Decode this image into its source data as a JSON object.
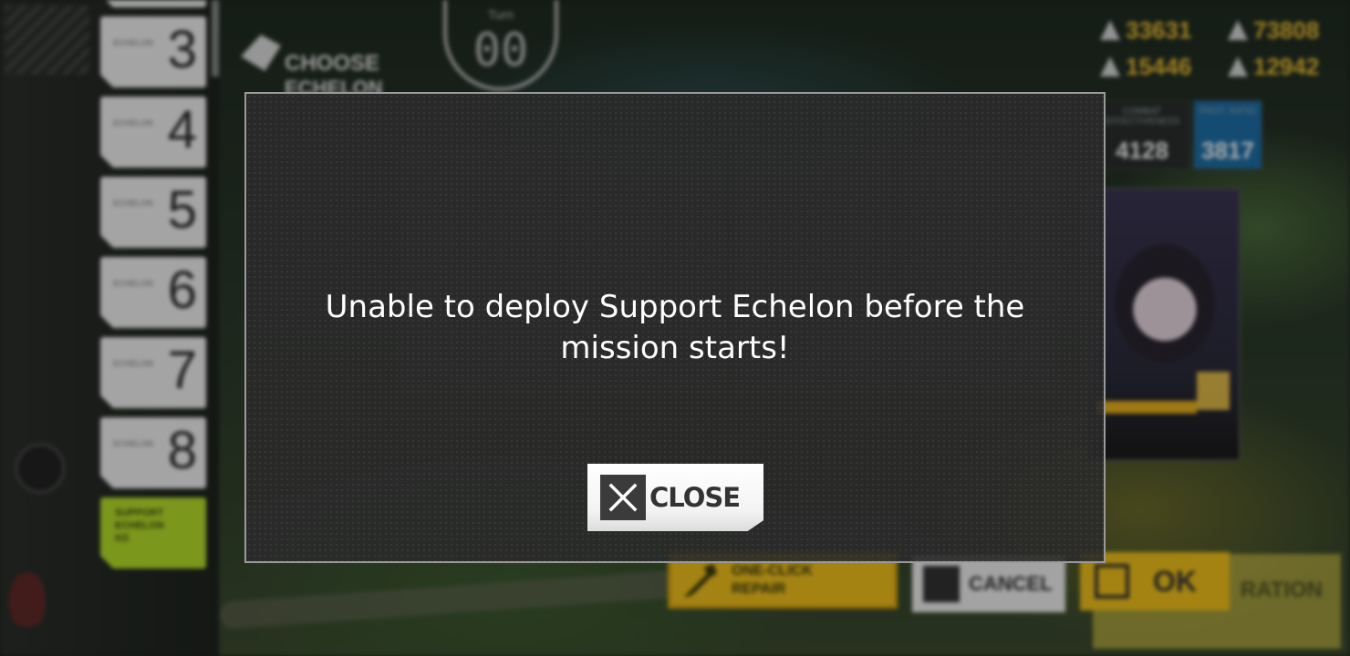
{
  "hud": {
    "choose_line1": "CHOOSE",
    "choose_line2": "ECHELON",
    "turn_label": "Turn",
    "turn_value": "00",
    "resources": {
      "manpower": "33631",
      "ammo": "73808",
      "rations": "15446",
      "parts": "12942"
    },
    "stats": {
      "effectiveness_label": "COMBAT EFFECTIVENESS",
      "effectiveness_value": "4128",
      "support_label": "PROT. RATIO",
      "support_value": "3817"
    }
  },
  "echelons": [
    {
      "label": "ECHELON",
      "num": "3"
    },
    {
      "label": "ECHELON",
      "num": "4"
    },
    {
      "label": "ECHELON",
      "num": "5"
    },
    {
      "label": "ECHELON",
      "num": "6"
    },
    {
      "label": "ECHELON",
      "num": "7"
    },
    {
      "label": "ECHELON",
      "num": "8"
    }
  ],
  "support_echelon": {
    "line1": "SUPPORT",
    "line2": "ECHELON",
    "line3": "0/2"
  },
  "bottom_buttons": {
    "repair_line1": "ONE-CLICK",
    "repair_line2": "REPAIR",
    "cancel": "CANCEL",
    "ok": "OK",
    "operation": "RATION"
  },
  "dialog": {
    "message": "Unable to deploy Support Echelon before the mission starts!",
    "close_label": "CLOSE"
  },
  "colors": {
    "accent_yellow": "#f2c21c",
    "support_green": "#b6df2a",
    "resource_gold": "#f1c232",
    "stat_blue": "#1e6fa8"
  }
}
